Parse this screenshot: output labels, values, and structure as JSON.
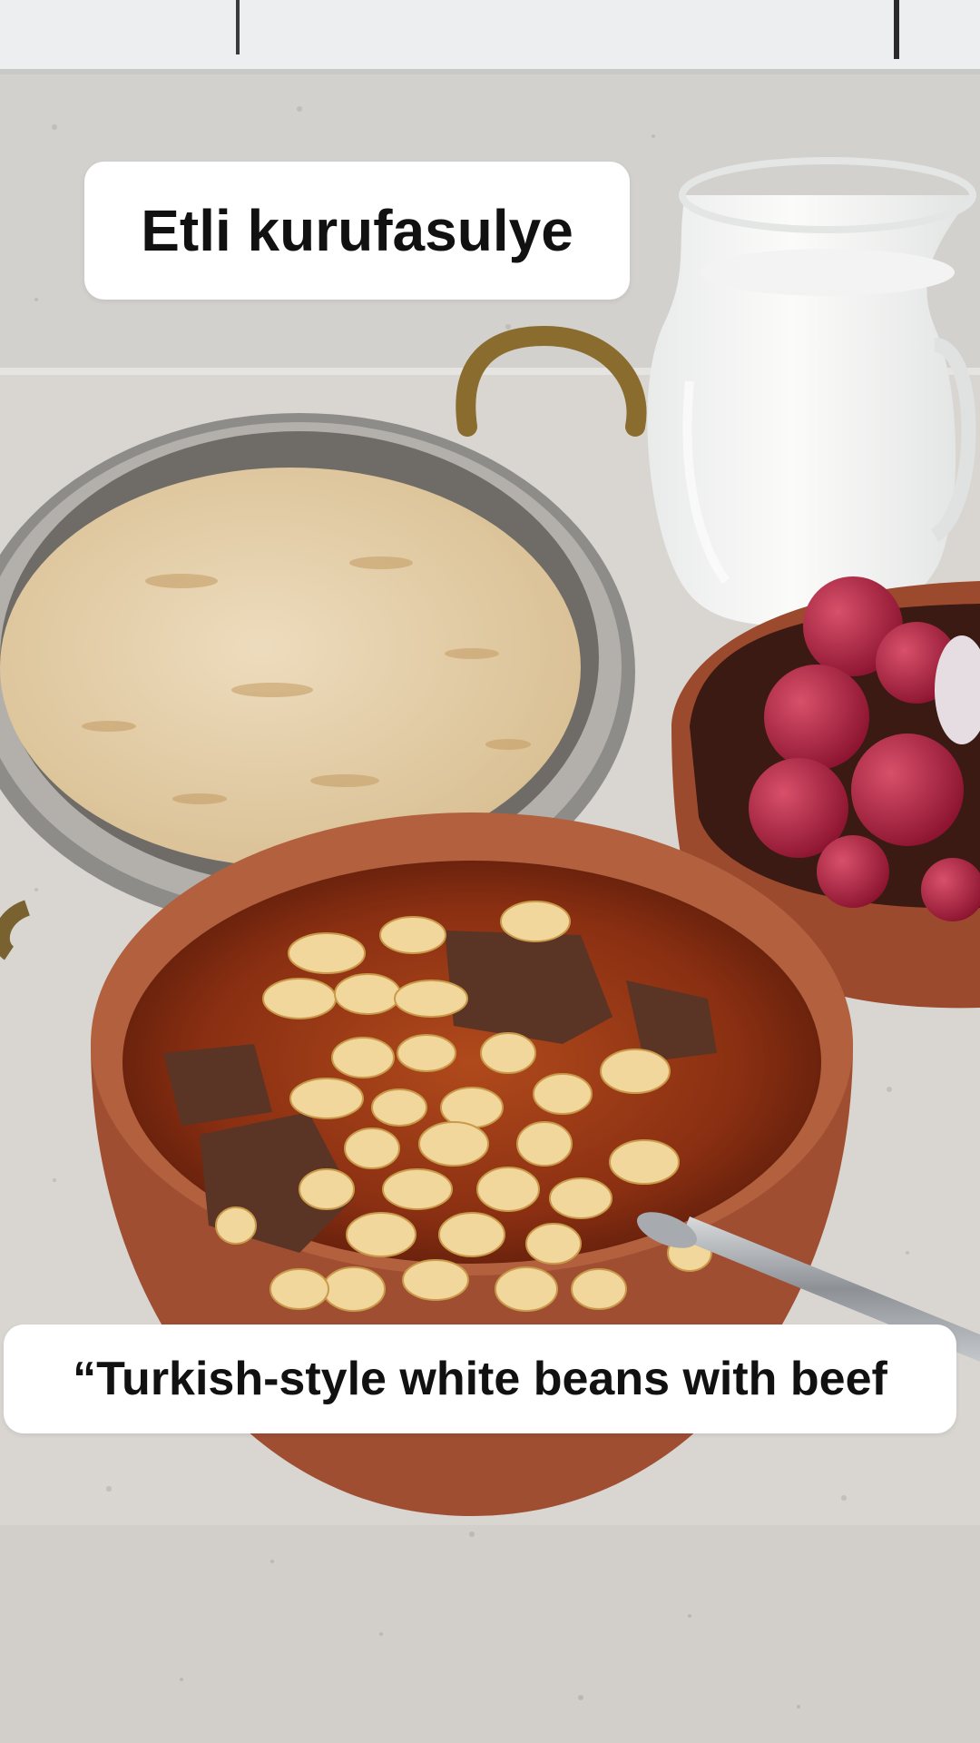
{
  "captions": {
    "top": "Etli kurufasulye",
    "bottom": "“Turkish-style white beans with beef"
  },
  "colors": {
    "countertop": "#d9d6d2",
    "backsplash": "#eceef0",
    "terracotta": "#a8553a",
    "stew_sauce": "#8a2f12",
    "beans": "#f2d9a0",
    "rice": "#e9d7b4",
    "milk": "#f7f7f5",
    "radish": "#b8263e",
    "caption_bg": "#ffffff",
    "caption_text": "#111111"
  },
  "objects": [
    "pilaf-rice-pan",
    "ayran-jug",
    "radish-bowl",
    "bean-stew-bowl",
    "spoon"
  ]
}
